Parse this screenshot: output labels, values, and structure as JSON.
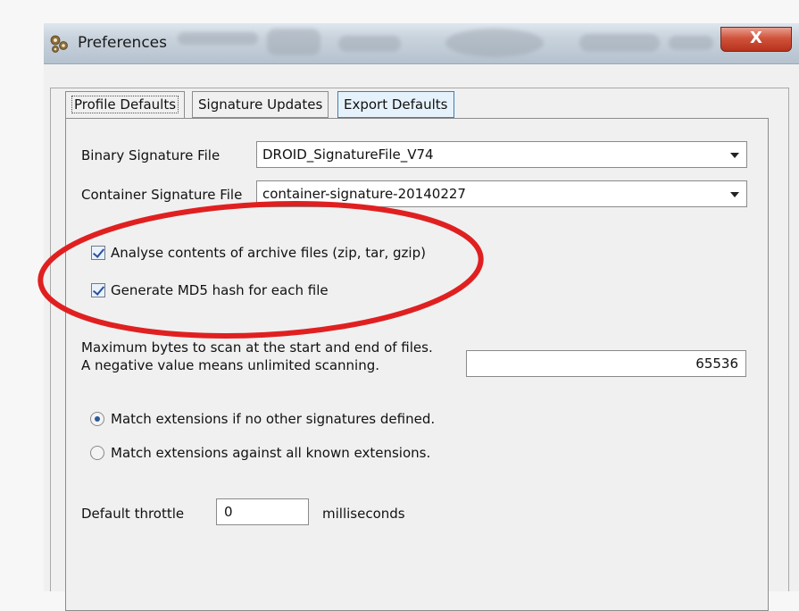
{
  "window": {
    "title": "Preferences",
    "close_label": "X"
  },
  "tabs": [
    {
      "label": "Profile Defaults",
      "active": true
    },
    {
      "label": "Signature Updates",
      "active": false
    },
    {
      "label": "Export Defaults",
      "active": false
    }
  ],
  "profile": {
    "binary_sig_label": "Binary Signature File",
    "binary_sig_value": "DROID_SignatureFile_V74",
    "container_sig_label": "Container Signature File",
    "container_sig_value": "container-signature-20140227",
    "analyse_archives_label": "Analyse contents of archive files (zip, tar, gzip)",
    "analyse_archives_checked": true,
    "md5_label": "Generate MD5 hash for each file",
    "md5_checked": true,
    "max_bytes_line1": "Maximum bytes to scan at the start and end of files.",
    "max_bytes_line2": "A negative value means unlimited scanning.",
    "max_bytes_value": "65536",
    "match_if_none_label": "Match extensions if no other signatures defined.",
    "match_all_label": "Match extensions against all known extensions.",
    "selected_match_option": "Match extensions if no other signatures defined.",
    "throttle_label": "Default throttle",
    "throttle_value": "0",
    "throttle_unit": "milliseconds"
  },
  "colors": {
    "annotation_ellipse": "#e02020",
    "close_button": "#d0533b"
  },
  "icons": {
    "app": "gear-cluster-icon",
    "dropdown": "chevron-down-icon"
  }
}
